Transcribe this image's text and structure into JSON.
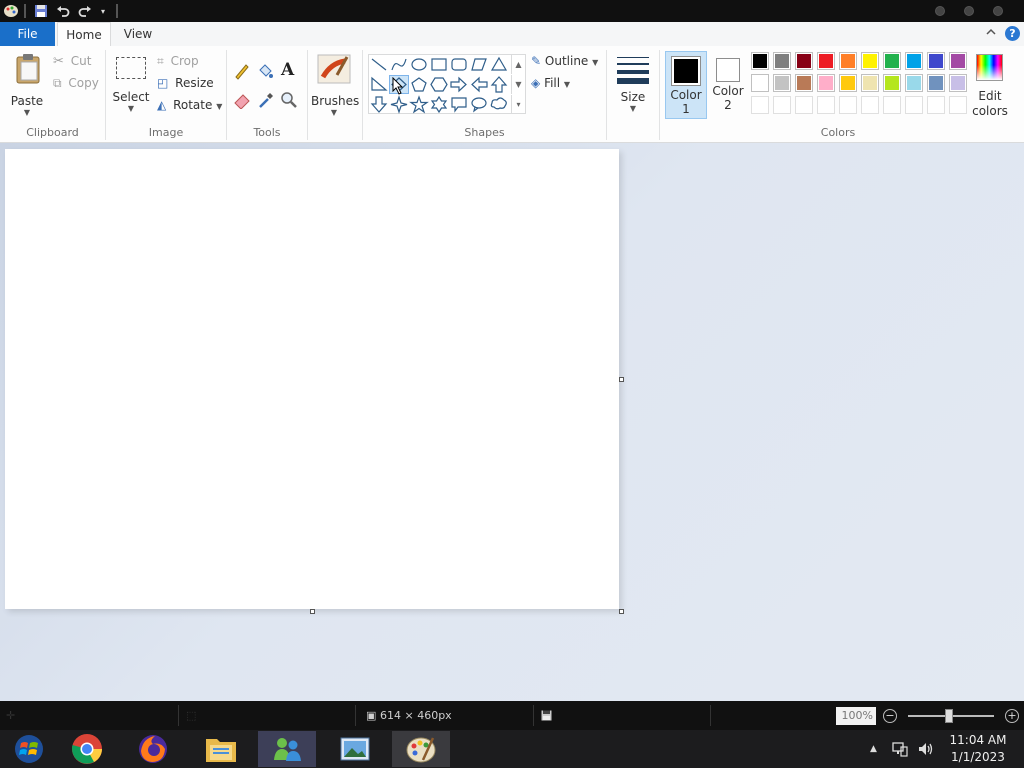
{
  "app": {
    "tabs": {
      "file": "File",
      "home": "Home",
      "view": "View"
    },
    "help": "?"
  },
  "clipboard": {
    "paste": "Paste",
    "cut": "Cut",
    "copy": "Copy",
    "group": "Clipboard"
  },
  "image": {
    "select": "Select",
    "crop": "Crop",
    "resize": "Resize",
    "rotate": "Rotate",
    "group": "Image"
  },
  "tools": {
    "group": "Tools"
  },
  "brushes": {
    "label": "Brushes"
  },
  "shapes": {
    "outline": "Outline",
    "fill": "Fill",
    "group": "Shapes"
  },
  "size": {
    "label": "Size"
  },
  "colors": {
    "color1_label": "Color 1",
    "color1_value": "#000000",
    "color2_label": "Color 2",
    "color2_value": "#ffffff",
    "edit_label": "Edit colors",
    "group": "Colors",
    "palette_row1": [
      "#000000",
      "#7f7f7f",
      "#880015",
      "#ed1c24",
      "#ff7f27",
      "#fff200",
      "#22b14c",
      "#00a2e8",
      "#3f48cc",
      "#a349a4"
    ],
    "palette_row2": [
      "#ffffff",
      "#c3c3c3",
      "#b97a57",
      "#ffaec9",
      "#ffc90e",
      "#efe4b0",
      "#b5e61d",
      "#99d9ea",
      "#7092be",
      "#c8bfe7"
    ]
  },
  "status": {
    "canvas_size": "614 × 460px",
    "zoom": "100%"
  },
  "taskbar": {
    "time": "11:04 AM",
    "date": "1/1/2023"
  }
}
